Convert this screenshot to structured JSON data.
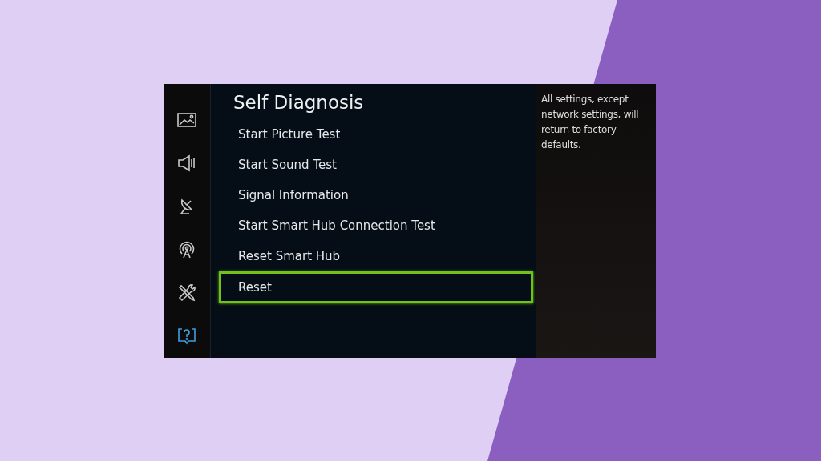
{
  "sidebar": {
    "items": [
      {
        "kind": "picture",
        "selected": false
      },
      {
        "kind": "sound",
        "selected": false
      },
      {
        "kind": "broadcast",
        "selected": false
      },
      {
        "kind": "network",
        "selected": false
      },
      {
        "kind": "tools",
        "selected": false
      },
      {
        "kind": "support",
        "selected": true
      }
    ]
  },
  "menu": {
    "title": "Self Diagnosis",
    "items": [
      {
        "label": "Start Picture Test",
        "selected": false
      },
      {
        "label": "Start Sound Test",
        "selected": false
      },
      {
        "label": "Signal Information",
        "selected": false
      },
      {
        "label": "Start Smart Hub Connection Test",
        "selected": false
      },
      {
        "label": "Reset Smart Hub",
        "selected": false
      },
      {
        "label": "Reset",
        "selected": true
      }
    ]
  },
  "description": "All settings, except network settings, will return to factory defaults."
}
